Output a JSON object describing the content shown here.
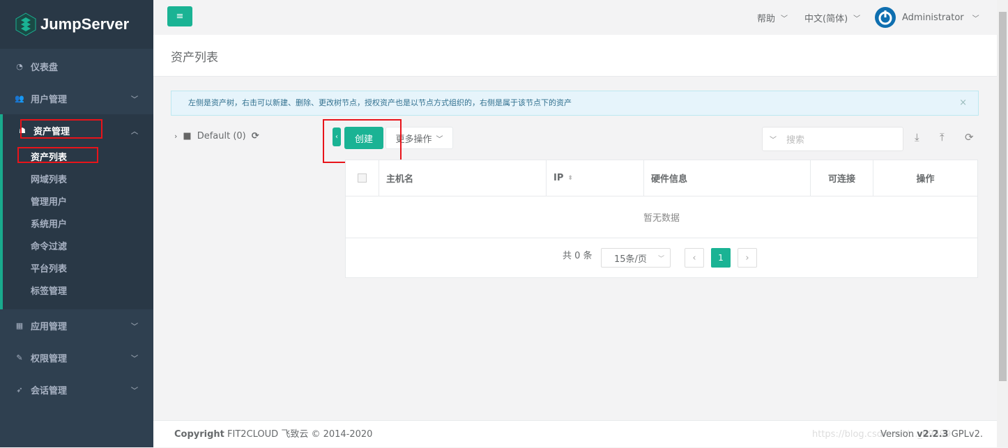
{
  "app": {
    "logo_text": "JumpServer",
    "brand_color": "#1ab394"
  },
  "sidebar": {
    "items": [
      {
        "label": "仪表盘",
        "icon": "dashboard-icon"
      },
      {
        "label": "用户管理",
        "icon": "users-icon"
      },
      {
        "label": "资产管理",
        "icon": "inbox-icon",
        "expanded": true,
        "children": [
          "资产列表",
          "网域列表",
          "管理用户",
          "系统用户",
          "命令过滤",
          "平台列表",
          "标签管理"
        ]
      },
      {
        "label": "应用管理",
        "icon": "grid-icon"
      },
      {
        "label": "权限管理",
        "icon": "edit-icon"
      },
      {
        "label": "会话管理",
        "icon": "rocket-icon"
      }
    ],
    "current": "资产列表"
  },
  "topbar": {
    "help": "帮助",
    "language": "中文(简体)",
    "user": "Administrator"
  },
  "page": {
    "title": "资产列表"
  },
  "alert": {
    "text": "左侧是资产树，右击可以新建、删除、更改树节点，授权资产也是以节点方式组织的，右侧是属于该节点下的资产"
  },
  "tree": {
    "node": "Default (0)"
  },
  "toolbar": {
    "create": "创建",
    "more": "更多操作",
    "search_placeholder": "搜索"
  },
  "table": {
    "columns": [
      "主机名",
      "IP",
      "硬件信息",
      "可连接",
      "操作"
    ],
    "empty": "暂无数据"
  },
  "pagination": {
    "total": "共 0 条",
    "page_size": "15条/页",
    "current_page": "1"
  },
  "footer": {
    "copyright_label": "Copyright",
    "copyright_text": "FIT2CLOUD 飞致云 © 2014-2020",
    "version_label": "Version",
    "version": "v2.2.3",
    "license": "GPLv2.",
    "watermark": "https://blog.csdn.net/..._69599"
  }
}
